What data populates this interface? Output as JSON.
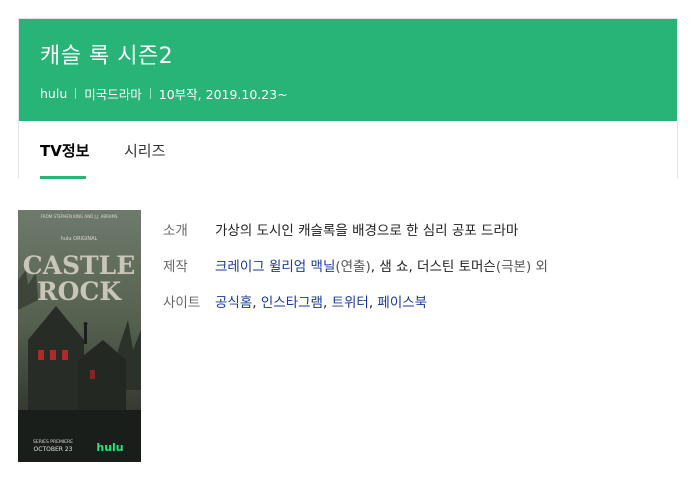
{
  "header": {
    "title": "캐슬 록 시즌2",
    "meta": [
      "hulu",
      "미국드라마",
      "10부작, 2019.10.23~"
    ],
    "bg_color": "#28b377"
  },
  "tabs": [
    {
      "label": "TV정보",
      "active": true
    },
    {
      "label": "시리즈",
      "active": false
    }
  ],
  "poster": {
    "top_text": "FROM STEPHEN KING AND J.J. ABRAMS",
    "logo_small": "hulu ORIGINAL",
    "title_line1": "CASTLE",
    "title_line2": "ROCK",
    "premiere": "SERIES PREMIERE",
    "date": "OCTOBER 23",
    "brand": "hulu"
  },
  "info": {
    "intro": {
      "label": "소개",
      "value": "가상의 도시인 캐슬록을 배경으로 한 심리 공포 드라마"
    },
    "production": {
      "label": "제작",
      "director": "크레이그 윌리엄 맥닐",
      "director_role": "(연출)",
      "writers": ", 샘 쇼, 더스틴 토머슨",
      "writers_role": "(극본) 외"
    },
    "site": {
      "label": "사이트",
      "links": [
        "공식홈",
        "인스타그램",
        "트위터",
        "페이스북"
      ],
      "separator": ", "
    }
  }
}
